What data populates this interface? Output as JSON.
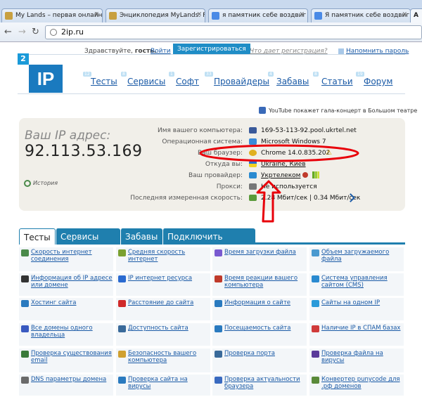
{
  "browser": {
    "tabs": [
      {
        "label": "My Lands – первая онлайн"
      },
      {
        "label": "Энциклопедия MyLands: F"
      },
      {
        "label": "я памятник себе воздвиг н"
      },
      {
        "label": "Я памятник себе воздвиг н"
      },
      {
        "label": "А"
      }
    ],
    "url": "2ip.ru"
  },
  "header": {
    "greeting": "Здравствуйте,",
    "guest": "гость.",
    "login": "Войти",
    "register": "Зарегистрироваться",
    "why_register": "Что дает регистрация?",
    "remind_password": "Напомнить пароль",
    "logo_num": "2",
    "logo_text": "IP"
  },
  "menu": {
    "items": [
      "Тесты",
      "Сервисы",
      "Софт",
      "Провайдеры",
      "Забавы",
      "Статьи",
      "Форум"
    ],
    "badges": [
      "12",
      "8",
      "1",
      "33",
      "4",
      "8",
      "19"
    ]
  },
  "news": "YouTube покажет гала-концерт в Большом театре",
  "ip_panel": {
    "title": "Ваш IP адрес:",
    "ip": "92.113.53.169",
    "history": "История",
    "rows": [
      {
        "label": "Имя вашего компьютера:",
        "value": "169-53-113-92.pool.ukrtel.net"
      },
      {
        "label": "Операционная система:",
        "value": "Microsoft Windows 7"
      },
      {
        "label": "Ваш браузер:",
        "value": "Chrome 14.0.835.202"
      },
      {
        "label": "Откуда вы:",
        "value": "Ukraine, Киев"
      },
      {
        "label": "Ваш провайдер:",
        "value": "Укртелеком"
      },
      {
        "label": "Прокси:",
        "value": "Не используется"
      },
      {
        "label": "Последняя измеренная скорость:",
        "value": "2.28 Мбит/сек | 0.34 Мбит/сек"
      }
    ]
  },
  "site_tabs": [
    "Тесты",
    "Сервисы",
    "Забавы",
    "Подключить интернет"
  ],
  "grid": [
    [
      "Скорость интернет соединения",
      "Средняя скорость интернет",
      "Время загрузки файла",
      "Объем загружаемого файла"
    ],
    [
      "Информация об IP адресе или домене",
      "IP интернет ресурса",
      "Время реакции вашего компьютера",
      "Система управления сайтом (CMS)"
    ],
    [
      "Хостинг сайта",
      "Расстояние до сайта",
      "Информация о сайте",
      "Сайты на одном IP"
    ],
    [
      "Все домены одного владельца",
      "Доступность сайта",
      "Посещаемость сайта",
      "Наличие IP в СПАМ базах"
    ],
    [
      "Проверка существования email",
      "Безопасность вашего компьютера",
      "Проверка порта",
      "Проверка файла на вирусы"
    ],
    [
      "DNS параметры домена",
      "Проверка сайта на вирусы",
      "Проверка актуальности браузера",
      "Конвертер punycode для .рф доменов"
    ]
  ],
  "colors": {
    "accent": "#1f7fae",
    "link": "#1a5aa6",
    "panel": "#f1efe9",
    "highlight": "#e8000a"
  }
}
